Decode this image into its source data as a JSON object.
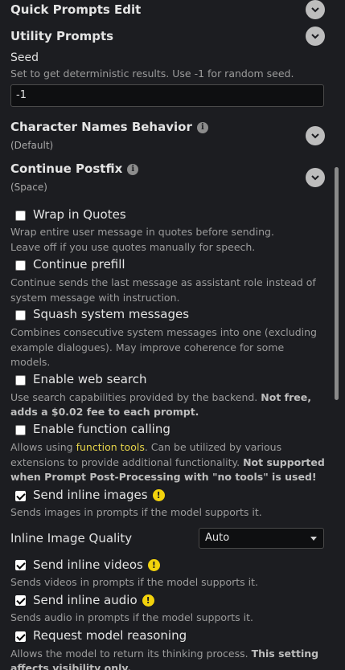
{
  "headers": {
    "quick_prompts": "Quick Prompts Edit",
    "utility_prompts": "Utility Prompts"
  },
  "seed": {
    "label": "Seed",
    "hint": "Set to get deterministic results. Use -1 for random seed.",
    "value": "-1"
  },
  "char_names": {
    "label": "Character Names Behavior",
    "value": "(Default)"
  },
  "continue_postfix": {
    "label": "Continue Postfix",
    "value": "(Space)"
  },
  "options": {
    "wrap_quotes": {
      "label": "Wrap in Quotes",
      "checked": false,
      "hint1": "Wrap entire user message in quotes before sending.",
      "hint2": "Leave off if you use quotes manually for speech."
    },
    "continue_prefill": {
      "label": "Continue prefill",
      "checked": false,
      "hint1": "Continue sends the last message as assistant role instead of",
      "hint2": "system message with instruction."
    },
    "squash": {
      "label": "Squash system messages",
      "checked": false,
      "hint1": "Combines consecutive system messages into one (excluding",
      "hint2": "example dialogues). May improve coherence for some",
      "hint3": "models."
    },
    "web_search": {
      "label": "Enable web search",
      "checked": false,
      "hint1": "Use search capabilities provided by the backend.",
      "hint1_strong": "Not free,",
      "hint2_strong": "adds a $0.02 fee to each prompt."
    },
    "function_calling": {
      "label": "Enable function calling",
      "checked": false,
      "hint1_pre": "Allows using",
      "hint1_link": "function tools",
      "hint1_post": ". Can be utilized by various",
      "hint2": "extensions to provide additional functionality.",
      "hint2_strong": "Not supported",
      "hint3_strong": "when Prompt Post-Processing with \"no tools\" is used!"
    },
    "inline_images": {
      "label": "Send inline images",
      "checked": true,
      "hint": "Sends images in prompts if the model supports it."
    },
    "inline_videos": {
      "label": "Send inline videos",
      "checked": true,
      "hint": "Sends videos in prompts if the model supports it."
    },
    "inline_audio": {
      "label": "Send inline audio",
      "checked": true,
      "hint": "Sends audio in prompts if the model supports it."
    },
    "reasoning": {
      "label": "Request model reasoning",
      "checked": true,
      "hint1": "Allows the model to return its thinking process.",
      "hint1_strong": "This setting",
      "hint2_strong": "affects visibility only."
    }
  },
  "image_quality": {
    "label": "Inline Image Quality",
    "value": "Auto"
  },
  "icons": {
    "chevron": "chevron-down-icon",
    "info": "info-icon",
    "warning": "warning-icon"
  },
  "colors": {
    "background": "#1c1d21",
    "warning": "#f2d20c",
    "link": "#e6d44a"
  }
}
